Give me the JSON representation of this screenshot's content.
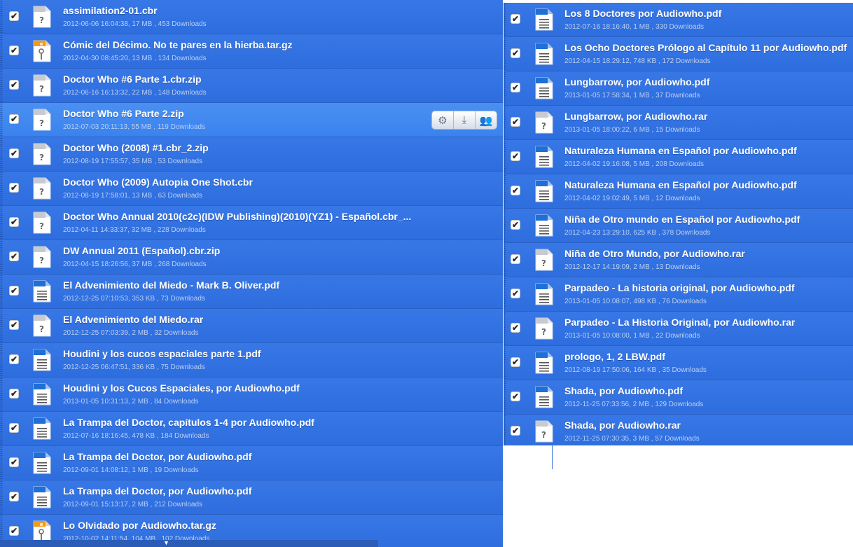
{
  "left_files": [
    {
      "name": "assimilation2-01.cbr",
      "meta": "2012-06-06 16:04:38, 17 MB , 453 Downloads",
      "icon": "unknown-file-icon"
    },
    {
      "name": "Cómic del Décimo. No te pares en la hierba.tar.gz",
      "meta": "2012-04-30 08:45:20, 13 MB , 134 Downloads",
      "icon": "archive-file-icon"
    },
    {
      "name": "Doctor Who #6 Parte 1.cbr.zip",
      "meta": "2012-06-16 16:13:32, 22 MB , 148 Downloads",
      "icon": "unknown-file-icon"
    },
    {
      "name": "Doctor Who #6 Parte 2.zip",
      "meta": "2012-07-03 20:11:13, 55 MB , 119 Downloads",
      "icon": "unknown-file-icon",
      "selected": true
    },
    {
      "name": "Doctor Who (2008) #1.cbr_2.zip",
      "meta": "2012-08-19 17:55:57, 35 MB , 53 Downloads",
      "icon": "unknown-file-icon"
    },
    {
      "name": "Doctor Who (2009) Autopia One Shot.cbr",
      "meta": "2012-08-19 17:58:01, 13 MB , 63 Downloads",
      "icon": "unknown-file-icon"
    },
    {
      "name": "Doctor Who Annual 2010(c2c)(IDW Publishing)(2010)(YZ1) - Español.cbr_...",
      "meta": "2012-04-11 14:33:37, 32 MB , 228 Downloads",
      "icon": "unknown-file-icon"
    },
    {
      "name": "DW Annual 2011 (Español).cbr.zip",
      "meta": "2012-04-15 18:26:56, 37 MB , 268 Downloads",
      "icon": "unknown-file-icon"
    },
    {
      "name": "El Advenimiento del Miedo - Mark B. Oliver.pdf",
      "meta": "2012-12-25 07:10:53, 353 KB , 73 Downloads",
      "icon": "document-file-icon"
    },
    {
      "name": "El Advenimiento del Miedo.rar",
      "meta": "2012-12-25 07:03:39, 2 MB , 32 Downloads",
      "icon": "unknown-file-icon"
    },
    {
      "name": "Houdini y los cucos espaciales parte 1.pdf",
      "meta": "2012-12-25 06:47:51, 336 KB , 75 Downloads",
      "icon": "document-file-icon"
    },
    {
      "name": "Houdini y los Cucos Espaciales, por Audiowho.pdf",
      "meta": "2013-01-05 10:31:13, 2 MB , 84 Downloads",
      "icon": "document-file-icon"
    },
    {
      "name": "La Trampa del Doctor, capítulos 1-4 por Audiowho.pdf",
      "meta": "2012-07-16 18:16:45, 478 KB , 184 Downloads",
      "icon": "document-file-icon"
    },
    {
      "name": "La Trampa del Doctor, por Audiowho.pdf",
      "meta": "2012-09-01 14:08:12, 1 MB , 19 Downloads",
      "icon": "document-file-icon"
    },
    {
      "name": "La Trampa del Doctor, por Audiowho.pdf",
      "meta": "2012-09-01 15:13:17, 2 MB , 212 Downloads",
      "icon": "document-file-icon"
    },
    {
      "name": "Lo Olvidado por Audiowho.tar.gz",
      "meta": "2012-10-02 14:11:54, 104 MB , 102 Downloads",
      "icon": "archive-file-icon"
    }
  ],
  "right_files": [
    {
      "name": "Los 8 Doctores por Audiowho.pdf",
      "meta": "2012-07-16 18:16:40, 1 MB , 330 Downloads",
      "icon": "document-file-icon"
    },
    {
      "name": "Los Ocho Doctores Prólogo al Capítulo 11 por Audiowho.pdf",
      "meta": "2012-04-15 18:29:12, 748 KB , 172 Downloads",
      "icon": "document-file-icon"
    },
    {
      "name": "Lungbarrow, por Audiowho.pdf",
      "meta": "2013-01-05 17:58:34, 1 MB , 37 Downloads",
      "icon": "document-file-icon"
    },
    {
      "name": "Lungbarrow, por Audiowho.rar",
      "meta": "2013-01-05 18:00:22, 6 MB , 15 Downloads",
      "icon": "unknown-file-icon"
    },
    {
      "name": "Naturaleza Humana en Español por Audiowho.pdf",
      "meta": "2012-04-02 19:16:08, 5 MB , 208 Downloads",
      "icon": "document-file-icon"
    },
    {
      "name": "Naturaleza Humana en Español por Audiowho.pdf",
      "meta": "2012-04-02 19:02:49, 5 MB , 12 Downloads",
      "icon": "document-file-icon"
    },
    {
      "name": "Niña de Otro mundo en Español por Audiowho.pdf",
      "meta": "2012-04-23 13:29:10, 625 KB , 378 Downloads",
      "icon": "document-file-icon"
    },
    {
      "name": "Niña de Otro Mundo, por Audiowho.rar",
      "meta": "2012-12-17 14:19:09, 2 MB , 13 Downloads",
      "icon": "unknown-file-icon"
    },
    {
      "name": "Parpadeo - La historia original, por Audiowho.pdf",
      "meta": "2013-01-05 10:08:07, 498 KB , 76 Downloads",
      "icon": "document-file-icon"
    },
    {
      "name": "Parpadeo - La Historia Original, por Audiowho.rar",
      "meta": "2013-01-05 10:08:00, 1 MB , 22 Downloads",
      "icon": "unknown-file-icon"
    },
    {
      "name": "prologo, 1, 2 LBW.pdf",
      "meta": "2012-08-19 17:50:06, 164 KB , 35 Downloads",
      "icon": "document-file-icon"
    },
    {
      "name": "Shada, por Audiowho.pdf",
      "meta": "2012-11-25 07:33:56, 2 MB , 129 Downloads",
      "icon": "document-file-icon"
    },
    {
      "name": "Shada, por Audiowho.rar",
      "meta": "2012-11-25 07:30:35, 3 MB , 57 Downloads",
      "icon": "unknown-file-icon"
    }
  ],
  "row_actions": [
    {
      "name": "settings-gear-icon",
      "glyph": "⚙"
    },
    {
      "name": "download-icon",
      "glyph": "⤓"
    },
    {
      "name": "share-users-icon",
      "glyph": "👥"
    }
  ],
  "checkmark": "✔",
  "colors": {
    "row_blue": "#2f6fe0",
    "selected_blue": "#4a90f2",
    "pdf_blue": "#1f6fd6",
    "archive_orange": "#f29a1c"
  }
}
